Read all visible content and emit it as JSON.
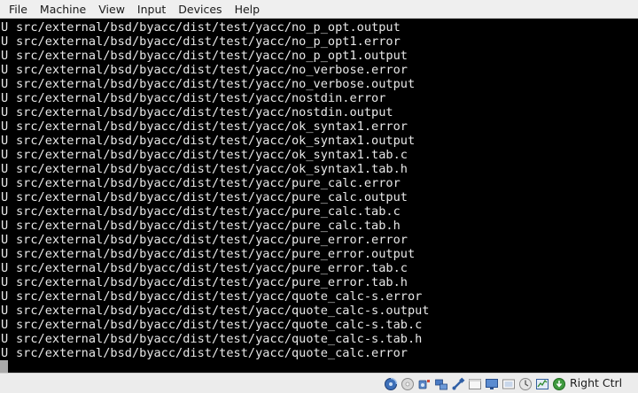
{
  "menubar": {
    "items": [
      "File",
      "Machine",
      "View",
      "Input",
      "Devices",
      "Help"
    ]
  },
  "console": {
    "lines": [
      {
        "flag": "U",
        "path": "src/external/bsd/byacc/dist/test/yacc/no_p_opt.output"
      },
      {
        "flag": "U",
        "path": "src/external/bsd/byacc/dist/test/yacc/no_p_opt1.error"
      },
      {
        "flag": "U",
        "path": "src/external/bsd/byacc/dist/test/yacc/no_p_opt1.output"
      },
      {
        "flag": "U",
        "path": "src/external/bsd/byacc/dist/test/yacc/no_verbose.error"
      },
      {
        "flag": "U",
        "path": "src/external/bsd/byacc/dist/test/yacc/no_verbose.output"
      },
      {
        "flag": "U",
        "path": "src/external/bsd/byacc/dist/test/yacc/nostdin.error"
      },
      {
        "flag": "U",
        "path": "src/external/bsd/byacc/dist/test/yacc/nostdin.output"
      },
      {
        "flag": "U",
        "path": "src/external/bsd/byacc/dist/test/yacc/ok_syntax1.error"
      },
      {
        "flag": "U",
        "path": "src/external/bsd/byacc/dist/test/yacc/ok_syntax1.output"
      },
      {
        "flag": "U",
        "path": "src/external/bsd/byacc/dist/test/yacc/ok_syntax1.tab.c"
      },
      {
        "flag": "U",
        "path": "src/external/bsd/byacc/dist/test/yacc/ok_syntax1.tab.h"
      },
      {
        "flag": "U",
        "path": "src/external/bsd/byacc/dist/test/yacc/pure_calc.error"
      },
      {
        "flag": "U",
        "path": "src/external/bsd/byacc/dist/test/yacc/pure_calc.output"
      },
      {
        "flag": "U",
        "path": "src/external/bsd/byacc/dist/test/yacc/pure_calc.tab.c"
      },
      {
        "flag": "U",
        "path": "src/external/bsd/byacc/dist/test/yacc/pure_calc.tab.h"
      },
      {
        "flag": "U",
        "path": "src/external/bsd/byacc/dist/test/yacc/pure_error.error"
      },
      {
        "flag": "U",
        "path": "src/external/bsd/byacc/dist/test/yacc/pure_error.output"
      },
      {
        "flag": "U",
        "path": "src/external/bsd/byacc/dist/test/yacc/pure_error.tab.c"
      },
      {
        "flag": "U",
        "path": "src/external/bsd/byacc/dist/test/yacc/pure_error.tab.h"
      },
      {
        "flag": "U",
        "path": "src/external/bsd/byacc/dist/test/yacc/quote_calc-s.error"
      },
      {
        "flag": "U",
        "path": "src/external/bsd/byacc/dist/test/yacc/quote_calc-s.output"
      },
      {
        "flag": "U",
        "path": "src/external/bsd/byacc/dist/test/yacc/quote_calc-s.tab.c"
      },
      {
        "flag": "U",
        "path": "src/external/bsd/byacc/dist/test/yacc/quote_calc-s.tab.h"
      },
      {
        "flag": "U",
        "path": "src/external/bsd/byacc/dist/test/yacc/quote_calc.error"
      }
    ]
  },
  "statusbar": {
    "icons": [
      "hard-disk-icon",
      "optical-drive-icon",
      "audio-icon",
      "network-icon",
      "usb-icon",
      "shared-folders-icon",
      "display-icon",
      "video-capture-icon",
      "mouse-integration-icon",
      "cpu-activity-icon",
      "keyboard-capture-icon"
    ],
    "host_key": "Right Ctrl"
  }
}
